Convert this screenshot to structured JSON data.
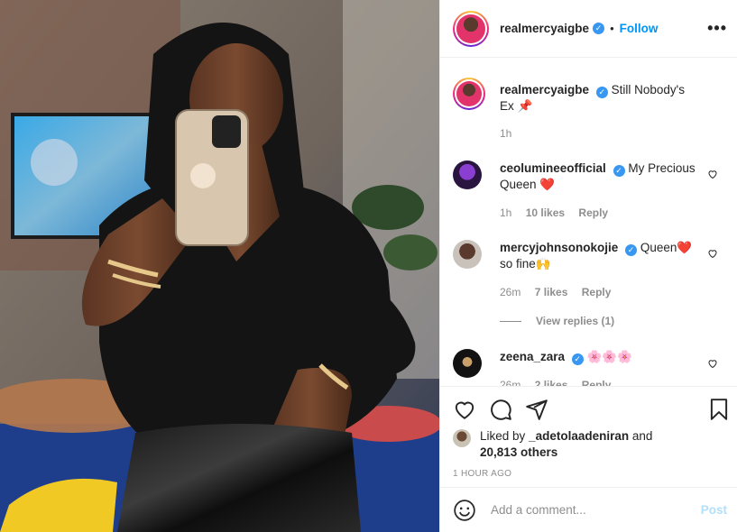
{
  "post": {
    "author": "realmercyaigbe",
    "follow_label": "Follow",
    "dot": "•",
    "more_label": "•••",
    "verified_mark": "✓"
  },
  "caption": {
    "user": "realmercyaigbe",
    "text": "Still Nobody's Ex",
    "emoji": "📌",
    "time": "1h"
  },
  "comments": [
    {
      "user": "ceolumineeofficial",
      "text": "My Precious Queen",
      "emoji": "❤️",
      "time": "1h",
      "likes": "10 likes",
      "reply_label": "Reply"
    },
    {
      "user": "mercyjohnsonokojie",
      "text": "Queen",
      "emoji": "❤️",
      "text2": "so fine",
      "emoji2": "🙌",
      "time": "26m",
      "likes": "7 likes",
      "reply_label": "Reply",
      "view_replies": "View replies (1)"
    },
    {
      "user": "zeena_zara",
      "text": "🌸🌸🌸",
      "time": "26m",
      "likes": "2 likes",
      "reply_label": "Reply"
    }
  ],
  "likes": {
    "prefix": "Liked by",
    "user": "_adetolaadeniran",
    "and": "and",
    "others": "20,813 others"
  },
  "timestamp": "1 HOUR AGO",
  "add_comment": {
    "placeholder": "Add a comment...",
    "post_label": "Post"
  },
  "icons": {
    "like": "heart-icon",
    "comment": "comment-icon",
    "share": "send-icon",
    "save": "bookmark-icon",
    "emoji": "smiley-icon",
    "comment_like": "heart-icon"
  },
  "colors": {
    "follow": "#0095f6",
    "post_disabled": "#b2dffc",
    "verified": "#3897f0",
    "muted": "#8e8e8e"
  }
}
